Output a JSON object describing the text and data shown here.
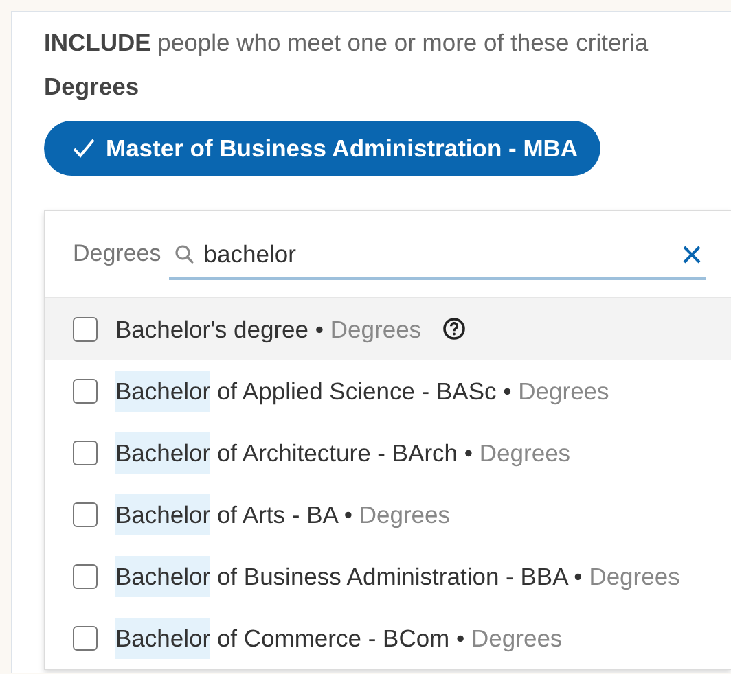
{
  "header": {
    "emphasis": "INCLUDE",
    "text": "people who meet one or more of these criteria"
  },
  "section_label": "Degrees",
  "selected_pills": [
    {
      "label": "Master of Business Administration - MBA",
      "checked": true
    }
  ],
  "separator": "•",
  "search": {
    "prefix": "Degrees",
    "value": "bachelor"
  },
  "results": [
    {
      "label": "Bachelor's degree",
      "category": "Degrees",
      "checked": false,
      "highlighted": true,
      "help": true
    },
    {
      "highlight": "Bachelor",
      "label": " of Applied Science - BASc",
      "category": "Degrees",
      "checked": false,
      "highlighted": false,
      "help": false
    },
    {
      "highlight": "Bachelor",
      "label": " of Architecture - BArch",
      "category": "Degrees",
      "checked": false,
      "highlighted": false,
      "help": false
    },
    {
      "highlight": "Bachelor",
      "label": " of Arts - BA",
      "category": "Degrees",
      "checked": false,
      "highlighted": false,
      "help": false
    },
    {
      "highlight": "Bachelor",
      "label": " of Business Administration - BBA",
      "category": "Degrees",
      "checked": false,
      "highlighted": false,
      "help": false
    },
    {
      "highlight": "Bachelor",
      "label": " of Commerce - BCom",
      "category": "Degrees",
      "checked": false,
      "highlighted": false,
      "help": false
    }
  ]
}
